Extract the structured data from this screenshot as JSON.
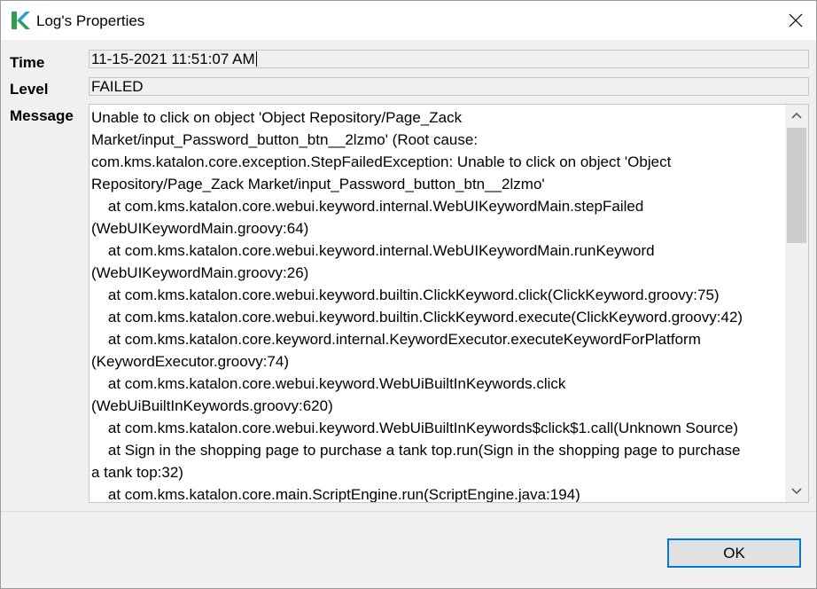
{
  "window": {
    "title": "Log's Properties",
    "icon": "katalon-logo-icon",
    "close_icon": "close-icon"
  },
  "fields": {
    "time_label": "Time",
    "time_value": "11-15-2021 11:51:07 AM",
    "level_label": "Level",
    "level_value": "FAILED",
    "message_label": "Message"
  },
  "message": {
    "lines": [
      "Unable to click on object 'Object Repository/Page_Zack",
      "Market/input_Password_button_btn__2lzmo' (Root cause:",
      "com.kms.katalon.core.exception.StepFailedException: Unable to click on object 'Object",
      "Repository/Page_Zack Market/input_Password_button_btn__2lzmo'",
      "    at com.kms.katalon.core.webui.keyword.internal.WebUIKeywordMain.stepFailed",
      "(WebUIKeywordMain.groovy:64)",
      "    at com.kms.katalon.core.webui.keyword.internal.WebUIKeywordMain.runKeyword",
      "(WebUIKeywordMain.groovy:26)",
      "    at com.kms.katalon.core.webui.keyword.builtin.ClickKeyword.click(ClickKeyword.groovy:75)",
      "    at com.kms.katalon.core.webui.keyword.builtin.ClickKeyword.execute(ClickKeyword.groovy:42)",
      "    at com.kms.katalon.core.keyword.internal.KeywordExecutor.executeKeywordForPlatform",
      "(KeywordExecutor.groovy:74)",
      "    at com.kms.katalon.core.webui.keyword.WebUiBuiltInKeywords.click",
      "(WebUiBuiltInKeywords.groovy:620)",
      "    at com.kms.katalon.core.webui.keyword.WebUiBuiltInKeywords$click$1.call(Unknown Source)",
      "    at Sign in the shopping page to purchase a tank top.run(Sign in the shopping page to purchase",
      "a tank top:32)",
      "    at com.kms.katalon.core.main.ScriptEngine.run(ScriptEngine.java:194)"
    ]
  },
  "buttons": {
    "ok_label": "OK"
  },
  "colors": {
    "accent": "#0078d7",
    "logo_green": "#2e9e4f",
    "logo_blue": "#29a0d8"
  }
}
